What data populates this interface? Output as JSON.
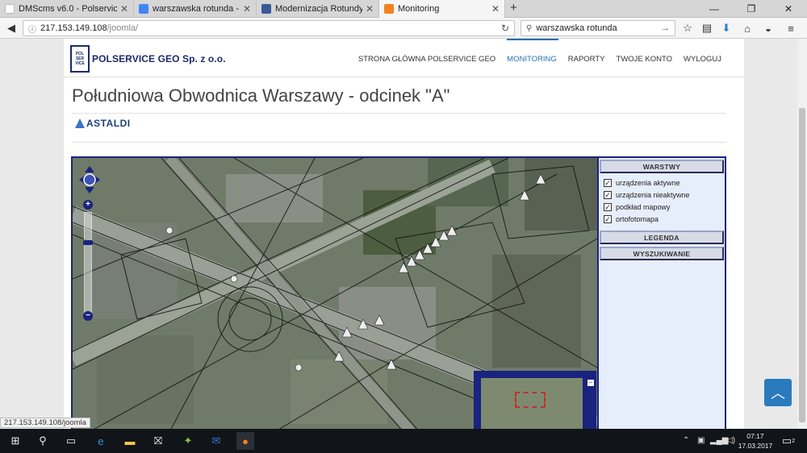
{
  "browser": {
    "tabs": [
      {
        "title": "DMScms v6.0 - Polservice",
        "icon_color": "#ffffff",
        "active": false
      },
      {
        "title": "warszawska rotunda - Szu...",
        "icon_color": "#4285f4",
        "active": false
      },
      {
        "title": "Modernizacja Rotundy - N...",
        "icon_color": "#3b5998",
        "active": false
      },
      {
        "title": "Monitoring",
        "icon_color": "#f4811f",
        "active": true
      }
    ],
    "new_tab_icon": "plus-icon",
    "url_host": "217.153.149.108",
    "url_path": "/joomla/",
    "search_query": "warszawska rotunda"
  },
  "site": {
    "logo_text": "POLSERVICE GEO Sp. z o.o.",
    "nav": [
      {
        "label": "STRONA GŁÓWNA POLSERVICE GEO",
        "active": false
      },
      {
        "label": "MONITORING",
        "active": true
      },
      {
        "label": "RAPORTY",
        "active": false
      },
      {
        "label": "TWOJE KONTO",
        "active": false
      },
      {
        "label": "WYLOGUJ",
        "active": false
      }
    ],
    "page_title": "Południowa Obwodnica Warszawy - odcinek \"A\"",
    "client_logo_text": "ASTALDI"
  },
  "map": {
    "panel": {
      "layers_header": "WARSTWY",
      "layers": [
        {
          "label": "urządzenia aktywne",
          "checked": true
        },
        {
          "label": "urządzenia nieaktywne",
          "checked": true
        },
        {
          "label": "podkład mapowy",
          "checked": true
        },
        {
          "label": "ortofotomapa",
          "checked": true
        }
      ],
      "legend_header": "LEGENDA",
      "search_header": "WYSZUKIWANIE"
    },
    "zoom_in_label": "+",
    "zoom_out_label": "−",
    "overview_toggle_label": "−"
  },
  "status_url": "217.153.149.108/joomla",
  "taskbar": {
    "time": "07:17",
    "date": "17.03.2017",
    "notifications": "2"
  },
  "colors": {
    "accent": "#2a6db5",
    "map_border": "#1a237e",
    "panel_bg": "#e6eefc"
  }
}
